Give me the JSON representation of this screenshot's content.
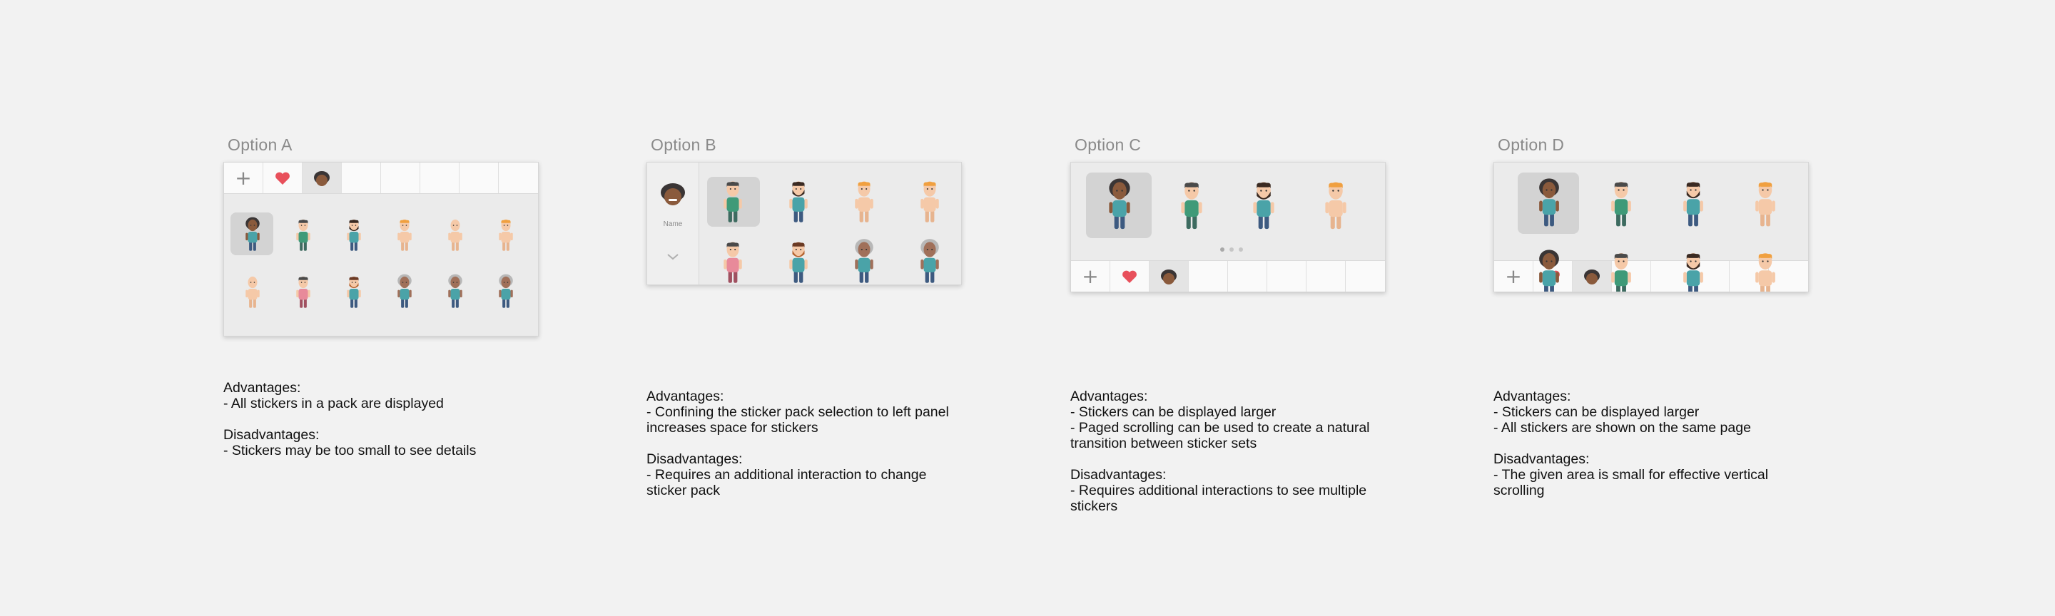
{
  "options": [
    {
      "title": "Option  A",
      "advantages_heading": "Advantages:",
      "advantages": [
        "- All stickers in a pack are displayed"
      ],
      "disadvantages_heading": "Disadvantages:",
      "disadvantages": [
        "- Stickers may be too small to see details"
      ]
    },
    {
      "title": "Option  B",
      "sidebar_label": "Name",
      "advantages_heading": "Advantages:",
      "advantages": [
        "- Confining the sticker pack selection to left panel",
        "increases space for stickers"
      ],
      "disadvantages_heading": "Disadvantages:",
      "disadvantages": [
        "- Requires an additional interaction to change",
        "sticker pack"
      ]
    },
    {
      "title": "Option  C",
      "advantages_heading": "Advantages:",
      "advantages": [
        "- Stickers can be displayed larger",
        "- Paged scrolling can be used to create a natural",
        "transition between sticker sets"
      ],
      "disadvantages_heading": "Disadvantages:",
      "disadvantages": [
        "- Requires additional interactions to see multiple",
        "stickers"
      ]
    },
    {
      "title": "Option  D",
      "advantages_heading": "Advantages:",
      "advantages": [
        "- Stickers can be displayed larger",
        "- All stickers are shown on the same page"
      ],
      "disadvantages_heading": "Disadvantages:",
      "disadvantages": [
        "- The given area is small for effective vertical",
        "scrolling"
      ]
    }
  ],
  "tabbar": {
    "add_label": "+",
    "icons": [
      "heart-icon",
      "pack-avatar-icon"
    ]
  },
  "colors": {
    "background": "#f2f2f2",
    "heart": "#e8505b",
    "teal_shirt": "#4aa3a8",
    "green_shirt": "#3f9a78",
    "pink_shirt": "#e88a9a",
    "skin": "#f5c9a8",
    "dark_skin": "#8a5a3c",
    "blond": "#f0a040",
    "brown_hair": "#6b3a24",
    "grey_hair": "#b8b8b8"
  }
}
